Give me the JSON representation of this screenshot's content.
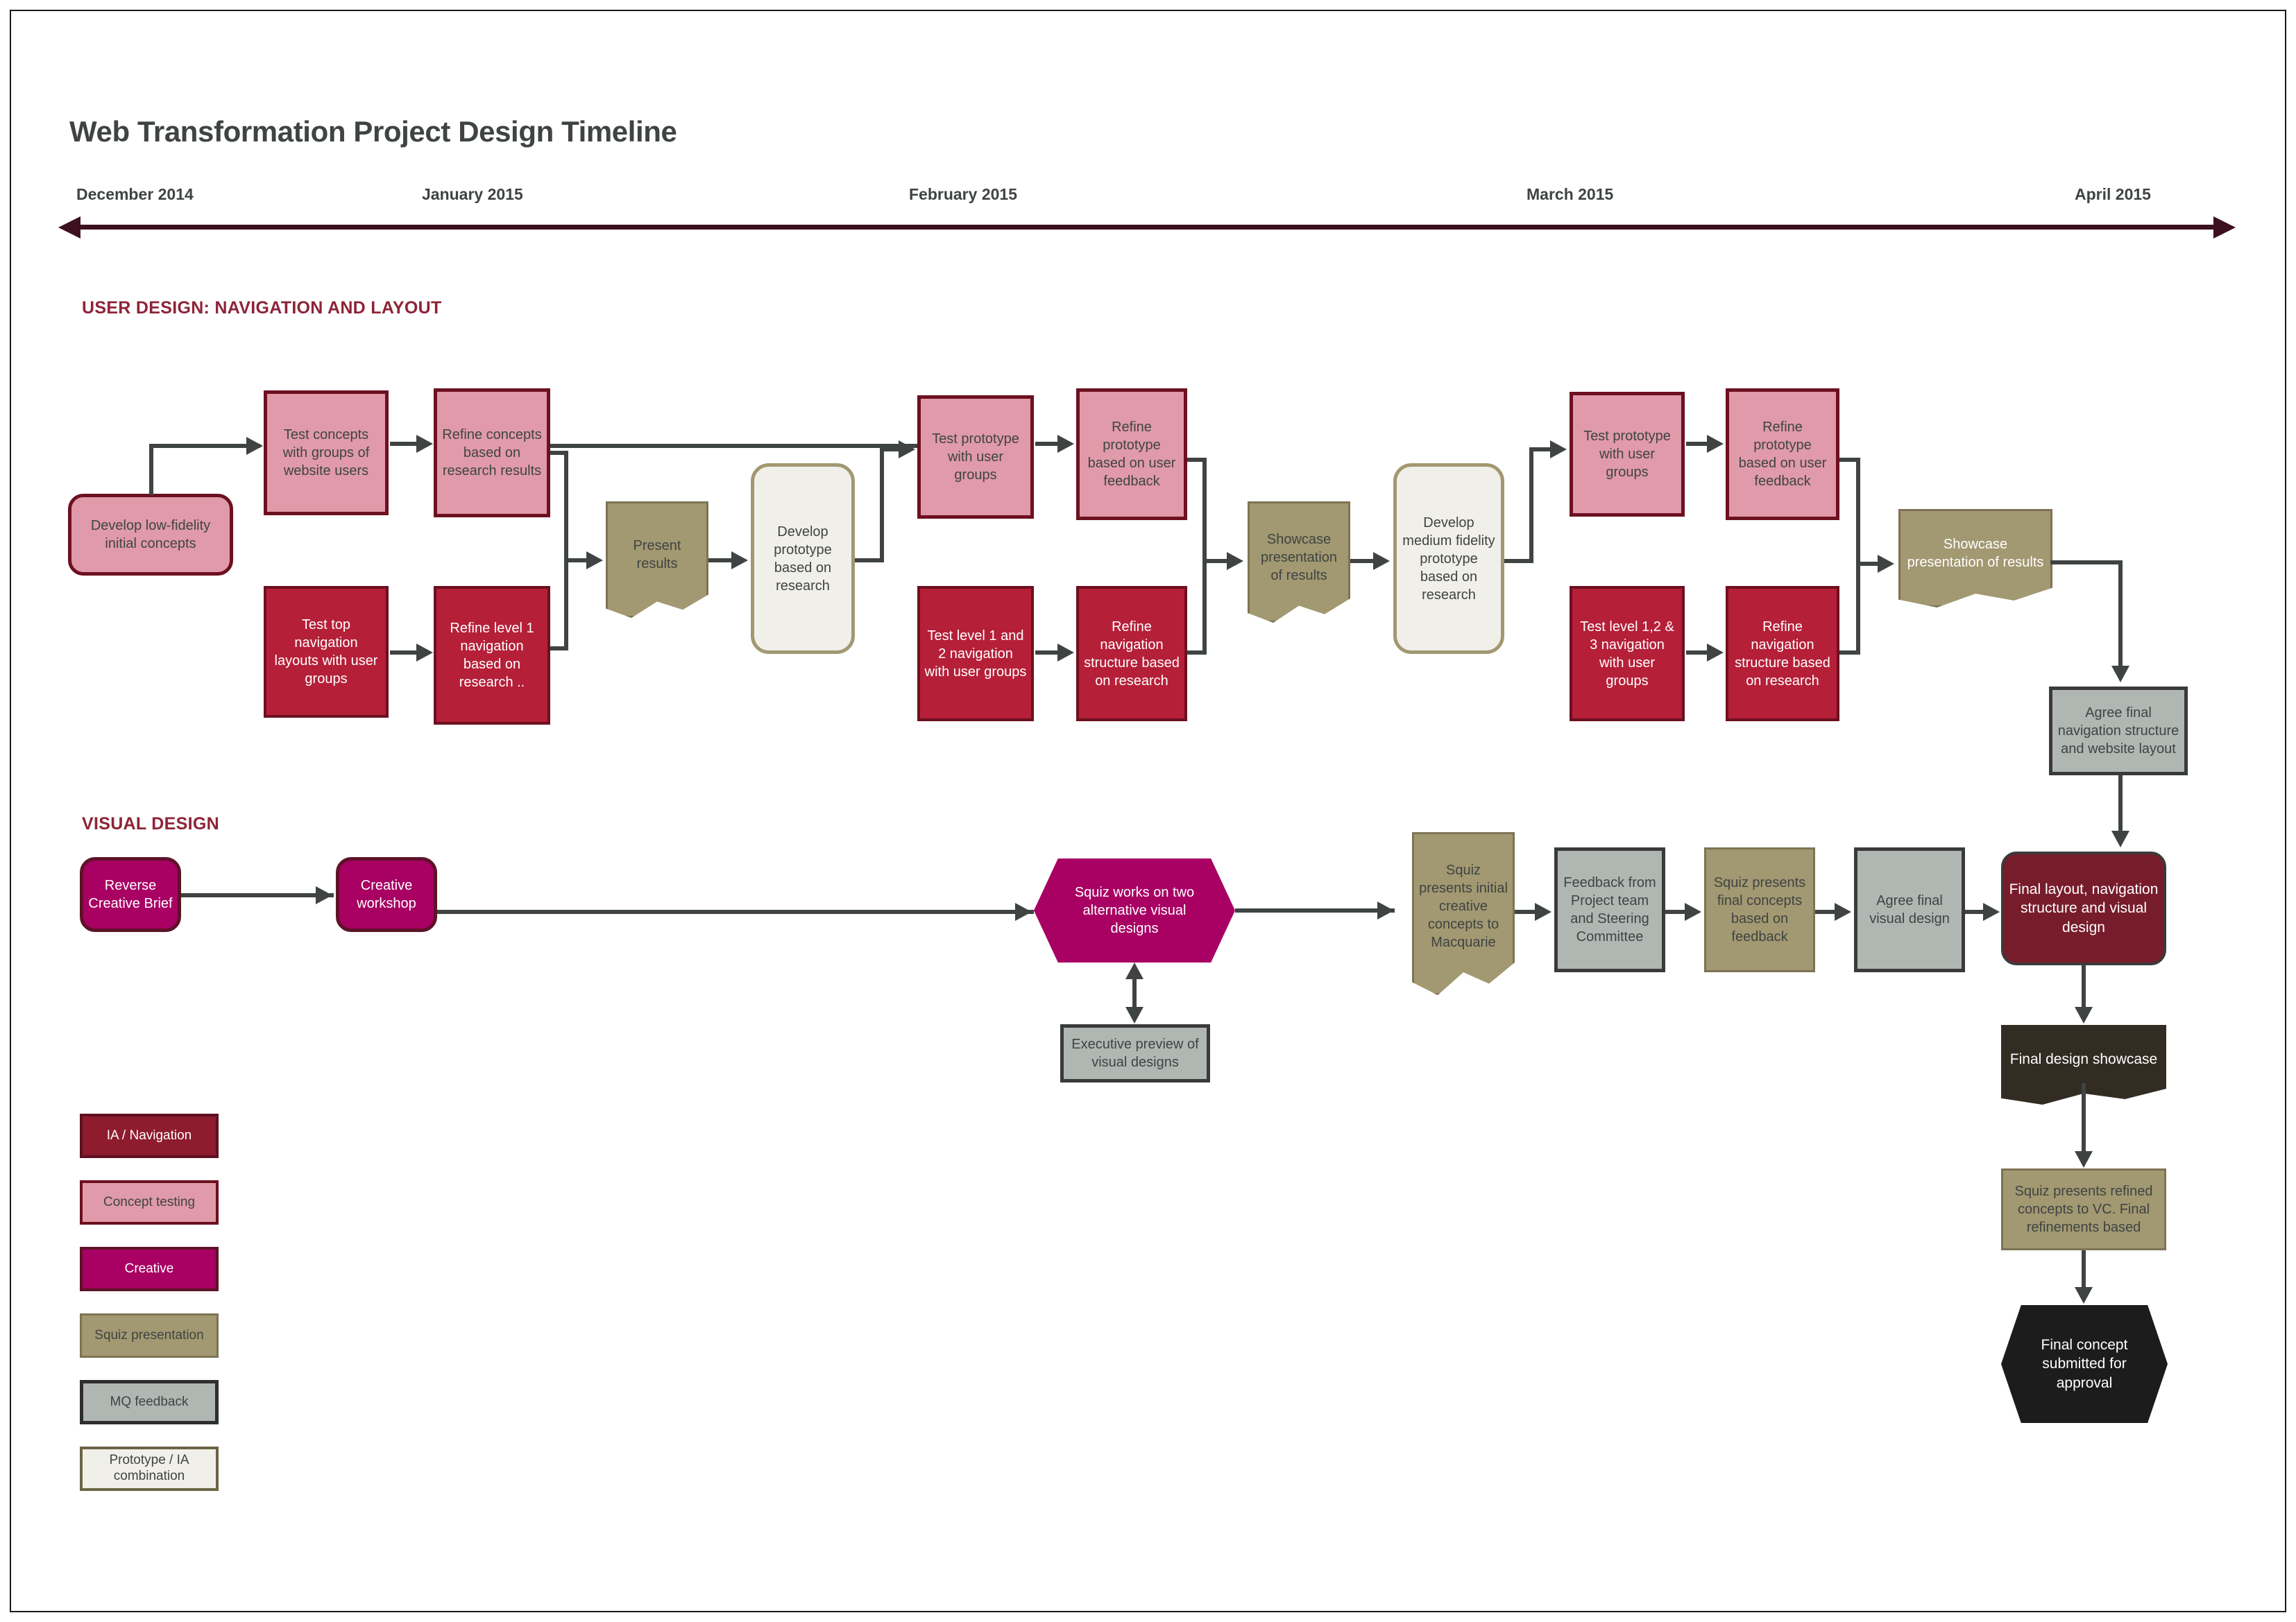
{
  "title": "Web Transformation Project Design Timeline",
  "timeline": {
    "labels": [
      "December 2014",
      "January 2015",
      "February 2015",
      "March 2015",
      "April 2015"
    ]
  },
  "sections": {
    "user_design": "USER DESIGN: NAVIGATION AND LAYOUT",
    "visual_design": "VISUAL DESIGN"
  },
  "user_design_nodes": {
    "develop_low_fidelity": "Develop low-fidelity initial concepts",
    "test_concepts_groups": "Test concepts with groups of website users",
    "refine_concepts_research": "Refine concepts based on research results",
    "test_top_nav_layouts": "Test top navigation layouts with user groups",
    "refine_level1_nav": "Refine level 1 navigation based on research ..",
    "present_results": "Present results",
    "develop_prototype_research": "Develop prototype based on research",
    "test_prototype_user_groups_1": "Test prototype with user groups",
    "refine_prototype_feedback_1": "Refine prototype based on user feedback",
    "test_level_1_2_nav": "Test level 1 and 2 navigation with user groups",
    "refine_nav_structure_1": "Refine navigation structure based on research",
    "showcase_presentation_1": "Showcase presentation of results",
    "develop_medium_fidelity": "Develop medium fidelity prototype based on research",
    "test_prototype_user_groups_2": "Test prototype with user groups",
    "refine_prototype_feedback_2": "Refine prototype based on user feedback",
    "test_level_123_nav": "Test level 1,2 & 3 navigation with user groups",
    "refine_nav_structure_2": "Refine navigation structure based on research",
    "showcase_presentation_2": "Showcase presentation of results",
    "agree_final_nav": "Agree final navigation structure and website layout"
  },
  "visual_design_nodes": {
    "reverse_creative_brief": "Reverse Creative Brief",
    "creative_workshop": "Creative workshop",
    "squiz_two_alternatives": "Squiz works on two alternative visual designs",
    "executive_preview": "Executive preview of visual designs",
    "squiz_presents_initial": "Squiz presents initial creative concepts to Macquarie",
    "feedback_project_team": "Feedback from Project team and Steering Committee",
    "squiz_presents_final": "Squiz presents final concepts based on feedback",
    "agree_final_visual": "Agree final visual design",
    "final_layout_nav_visual": "Final layout, navigation structure and visual design",
    "final_design_showcase": "Final design showcase",
    "squiz_presents_refined": "Squiz presents refined concepts to VC. Final refinements based",
    "final_concept_approval": "Final concept submitted for approval"
  },
  "legend": [
    {
      "label": "IA / Navigation",
      "color": "#8e1b2e"
    },
    {
      "label": "Concept testing",
      "color": "#e09aa9"
    },
    {
      "label": "Creative",
      "color": "#a80063"
    },
    {
      "label": "Squiz presentation",
      "color": "#a29871"
    },
    {
      "label": "MQ feedback",
      "color": "#b0b7b3"
    },
    {
      "label": "Prototype / IA combination",
      "color": "#f1efe9"
    }
  ],
  "colors": {
    "accent_dark_red": "#3d1020",
    "heading_red": "#8e2337",
    "text_dark": "#3f4443",
    "connector": "#3f4443"
  }
}
